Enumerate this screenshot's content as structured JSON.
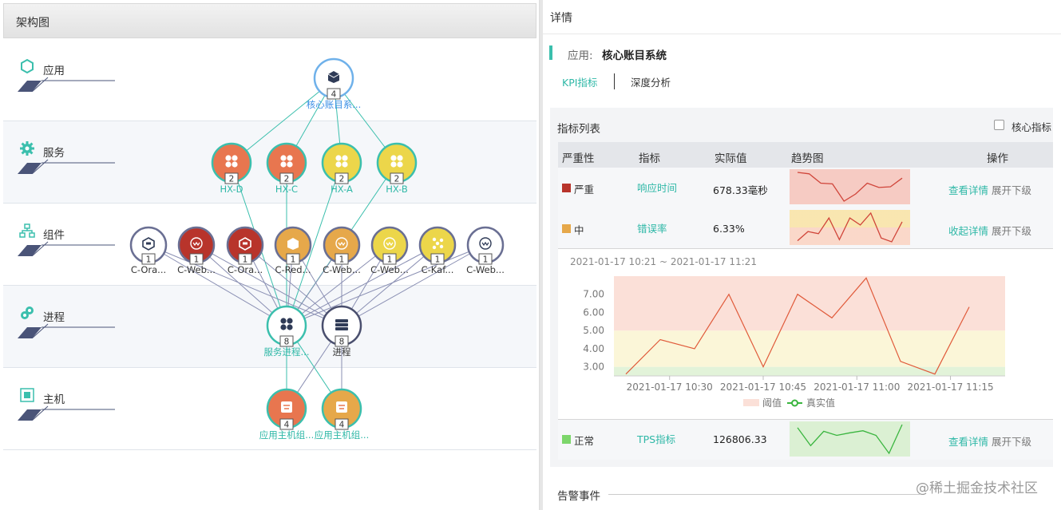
{
  "left_panel": {
    "title": "架构图",
    "layers": [
      {
        "label": "应用"
      },
      {
        "label": "服务"
      },
      {
        "label": "组件"
      },
      {
        "label": "进程"
      },
      {
        "label": "主机"
      }
    ],
    "app_node": {
      "label": "核心账目系...",
      "count": "4"
    },
    "service_nodes": [
      {
        "label": "HX-D",
        "count": "2",
        "color": "#e8764f"
      },
      {
        "label": "HX-C",
        "count": "2",
        "color": "#e8764f"
      },
      {
        "label": "HX-A",
        "count": "2",
        "color": "#ecd64a"
      },
      {
        "label": "HX-B",
        "count": "2",
        "color": "#ecd64a"
      }
    ],
    "component_nodes": [
      {
        "label": "C-Ora...",
        "count": "1",
        "color": "#ffffff",
        "icon": "database-icon"
      },
      {
        "label": "C-Web...",
        "count": "1",
        "color": "#b8342b",
        "icon": "web-icon"
      },
      {
        "label": "C-Ora...",
        "count": "1",
        "color": "#b8342b",
        "icon": "database-icon"
      },
      {
        "label": "C-Red...",
        "count": "1",
        "color": "#e6a84a",
        "icon": "cube-icon"
      },
      {
        "label": "C-Web...",
        "count": "1",
        "color": "#e6a84a",
        "icon": "web-icon"
      },
      {
        "label": "C-Web...",
        "count": "1",
        "color": "#ecd64a",
        "icon": "web-icon"
      },
      {
        "label": "C-Kaf...",
        "count": "1",
        "color": "#ecd64a",
        "icon": "kafka-icon"
      },
      {
        "label": "C-Web...",
        "count": "1",
        "color": "#ffffff",
        "icon": "web-icon"
      }
    ],
    "process_nodes": [
      {
        "label": "服务进程...",
        "count": "8"
      },
      {
        "label": "进程",
        "count": "8"
      }
    ],
    "host_nodes": [
      {
        "label": "应用主机组...",
        "count": "4",
        "color": "#e8764f"
      },
      {
        "label": "应用主机组...",
        "count": "4",
        "color": "#e6a84a"
      }
    ]
  },
  "right_panel": {
    "title": "详情",
    "app_prefix": "应用:",
    "app_name": "核心账目系统",
    "tabs": [
      {
        "label": "KPI指标",
        "active": true
      },
      {
        "label": "深度分析",
        "active": false
      }
    ],
    "kpi_list_title": "指标列表",
    "core_checkbox_label": "核心指标",
    "table_headers": [
      "严重性",
      "指标",
      "实际值",
      "趋势图",
      "操作"
    ],
    "rows": [
      {
        "severity": "严重",
        "severity_color": "#b8342b",
        "name": "响应时间",
        "value": "678.33毫秒",
        "op_link": "查看详情",
        "op_expand": "展开下级",
        "spark": [
          7.0,
          6.8,
          5.5,
          5.4,
          3.0,
          4.0,
          5.5,
          4.9,
          5.0,
          6.2
        ]
      },
      {
        "severity": "中",
        "severity_color": "#e6a84a",
        "name": "错误率",
        "value": "6.33%",
        "op_link": "收起详情",
        "op_expand": "展开下级",
        "spark": [
          2.8,
          4.5,
          4.1,
          7.0,
          3.0,
          7.0,
          5.7,
          7.9,
          3.3,
          2.6,
          6.3
        ]
      },
      {
        "severity": "正常",
        "severity_color": "#7dd66b",
        "name": "TPS指标",
        "value": "126806.33",
        "op_link": "查看详情",
        "op_expand": "展开下级",
        "spark": [
          7.0,
          3.5,
          6.3,
          5.5,
          6.0,
          6.4,
          5.5,
          2.0,
          7.6
        ]
      }
    ],
    "alarm_title": "告警事件"
  },
  "chart_data": {
    "type": "line",
    "subtitle": "2021-01-17 10:21 ~ 2021-01-17 11:21",
    "x": [
      "10:21",
      "10:26",
      "10:31",
      "10:36",
      "10:41",
      "10:46",
      "10:51",
      "10:56",
      "11:01",
      "11:06",
      "11:11",
      "11:16"
    ],
    "x_tick_labels": [
      "2021-01-17 10:30",
      "2021-01-17 10:45",
      "2021-01-17 11:00",
      "2021-01-17 11:15"
    ],
    "y_ticks": [
      "3.00",
      "4.00",
      "5.00",
      "6.00",
      "7.00"
    ],
    "ylim": [
      2.5,
      8.0
    ],
    "series": [
      {
        "name": "真实值",
        "color": "#e05a3a",
        "values": [
          2.6,
          4.5,
          4.0,
          7.0,
          3.0,
          7.0,
          5.7,
          7.9,
          3.3,
          2.6,
          6.3
        ]
      }
    ],
    "threshold_legend": "阈值",
    "threshold_bands": [
      {
        "from": 2.5,
        "to": 3.0,
        "color": "#e2f3d9"
      },
      {
        "from": 3.0,
        "to": 5.0,
        "color": "#fbf6d8"
      },
      {
        "from": 5.0,
        "to": 8.0,
        "color": "#fbe0d8"
      }
    ]
  },
  "watermark": "@稀土掘金技术社区"
}
